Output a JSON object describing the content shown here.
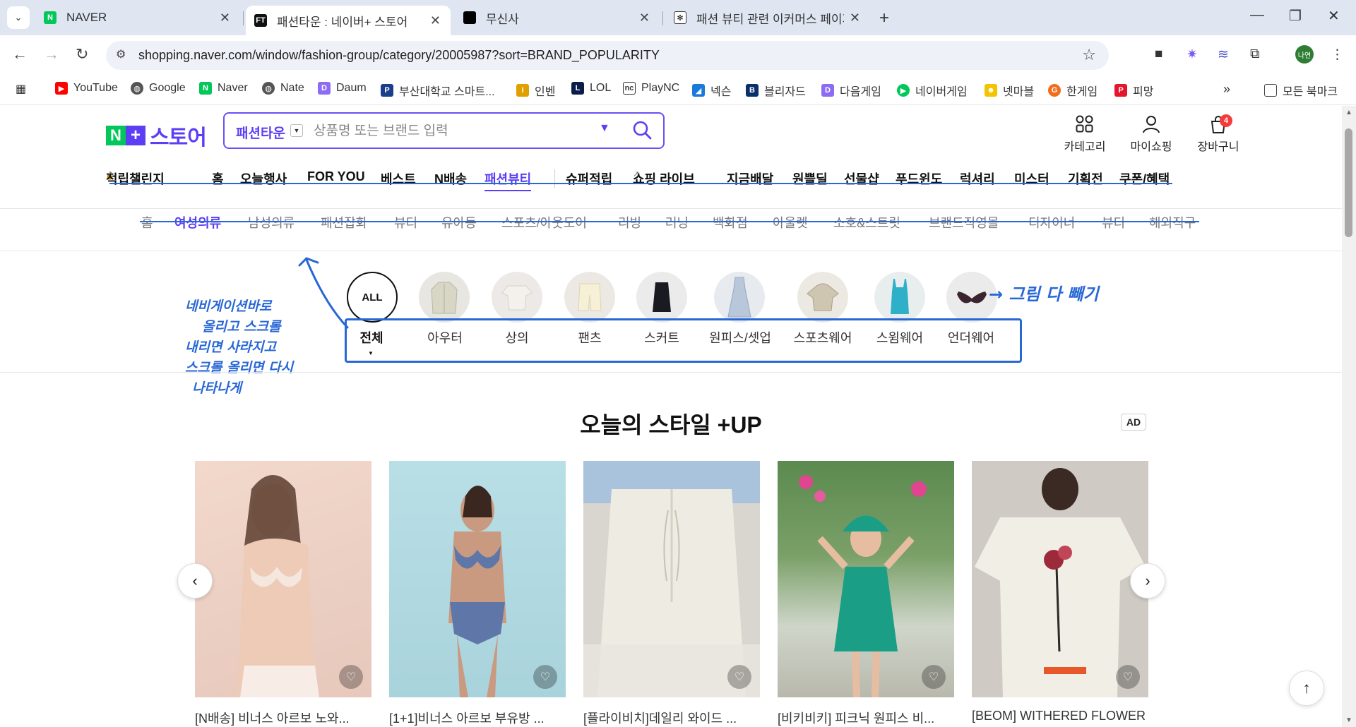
{
  "browser": {
    "tabs": [
      {
        "title": "NAVER",
        "favicon": "naver-favicon",
        "active": false
      },
      {
        "title": "패션타운 : 네이버+ 스토어",
        "favicon": "fashiontown-favicon",
        "active": true
      },
      {
        "title": "무신사",
        "favicon": "musinsa-favicon",
        "active": false
      },
      {
        "title": "패션 뷰티 관련 이커머스 페이지",
        "favicon": "notion-favicon",
        "active": false
      }
    ],
    "url": "shopping.naver.com/window/fashion-group/category/20005987?sort=BRAND_POPULARITY",
    "profile_label": "나연",
    "bookmarks": [
      "YouTube",
      "Google",
      "Naver",
      "Nate",
      "Daum",
      "부산대학교 스마트...",
      "인벤",
      "LOL",
      "PlayNC",
      "넥슨",
      "블리자드",
      "다음게임",
      "네이버게임",
      "넷마블",
      "한게임",
      "피망"
    ],
    "bookmarks_folder": "모든 북마크"
  },
  "header": {
    "logo_text": "스토어",
    "search_scope": "패션타운",
    "search_placeholder": "상품명 또는 브랜드 입력",
    "utils": {
      "category": "카테고리",
      "myshopping": "마이쇼핑",
      "cart": "장바구니",
      "cart_count": "4"
    }
  },
  "gnb": [
    "적립챌린지",
    "홈",
    "오늘행사",
    "FOR YOU",
    "베스트",
    "N배송",
    "패션뷰티",
    "슈퍼적립",
    "쇼핑 라이브",
    "지금배달",
    "원쁠딜",
    "선물샵",
    "푸드윈도",
    "럭셔리",
    "미스터",
    "기획전",
    "쿠폰/혜택"
  ],
  "gnb_active": "패션뷰티",
  "subnav": [
    "홈",
    "여성의류",
    "남성의류",
    "패션잡화",
    "뷰티",
    "유아동",
    "스포츠/아웃도어",
    "리빙",
    "러닝",
    "백화점",
    "아울렛",
    "소호&스트릿",
    "브랜드직영몰",
    "디자이너",
    "뷰티",
    "해외직구"
  ],
  "subnav_active": "여성의류",
  "categories": {
    "all_label": "ALL",
    "items": [
      "전체",
      "아우터",
      "상의",
      "팬츠",
      "스커트",
      "원피스/셋업",
      "스포츠웨어",
      "스윔웨어",
      "언더웨어"
    ]
  },
  "annotations": {
    "left_note": [
      "네비게이션바로",
      "올리고 스크롤",
      "내리면 사라지고",
      "스크롤 올리면 다시",
      "나타나게"
    ],
    "right_note": "→ 그림 다 빼기"
  },
  "section": {
    "title": "오늘의 스타일 +UP",
    "ad_label": "AD"
  },
  "products": [
    {
      "name": "[N배송] 비너스 아르보 노와..."
    },
    {
      "name": "[1+1]비너스 아르보 부유방 ..."
    },
    {
      "name": "[플라이비치]데일리 와이드 ..."
    },
    {
      "name": "[비키비키] 피크닉 원피스 비..."
    },
    {
      "name": "[BEOM] WITHERED FLOWER ..."
    }
  ],
  "colors": {
    "brand_purple": "#5d3ef5",
    "naver_green": "#03c75a",
    "annotation_blue": "#2867d6"
  }
}
